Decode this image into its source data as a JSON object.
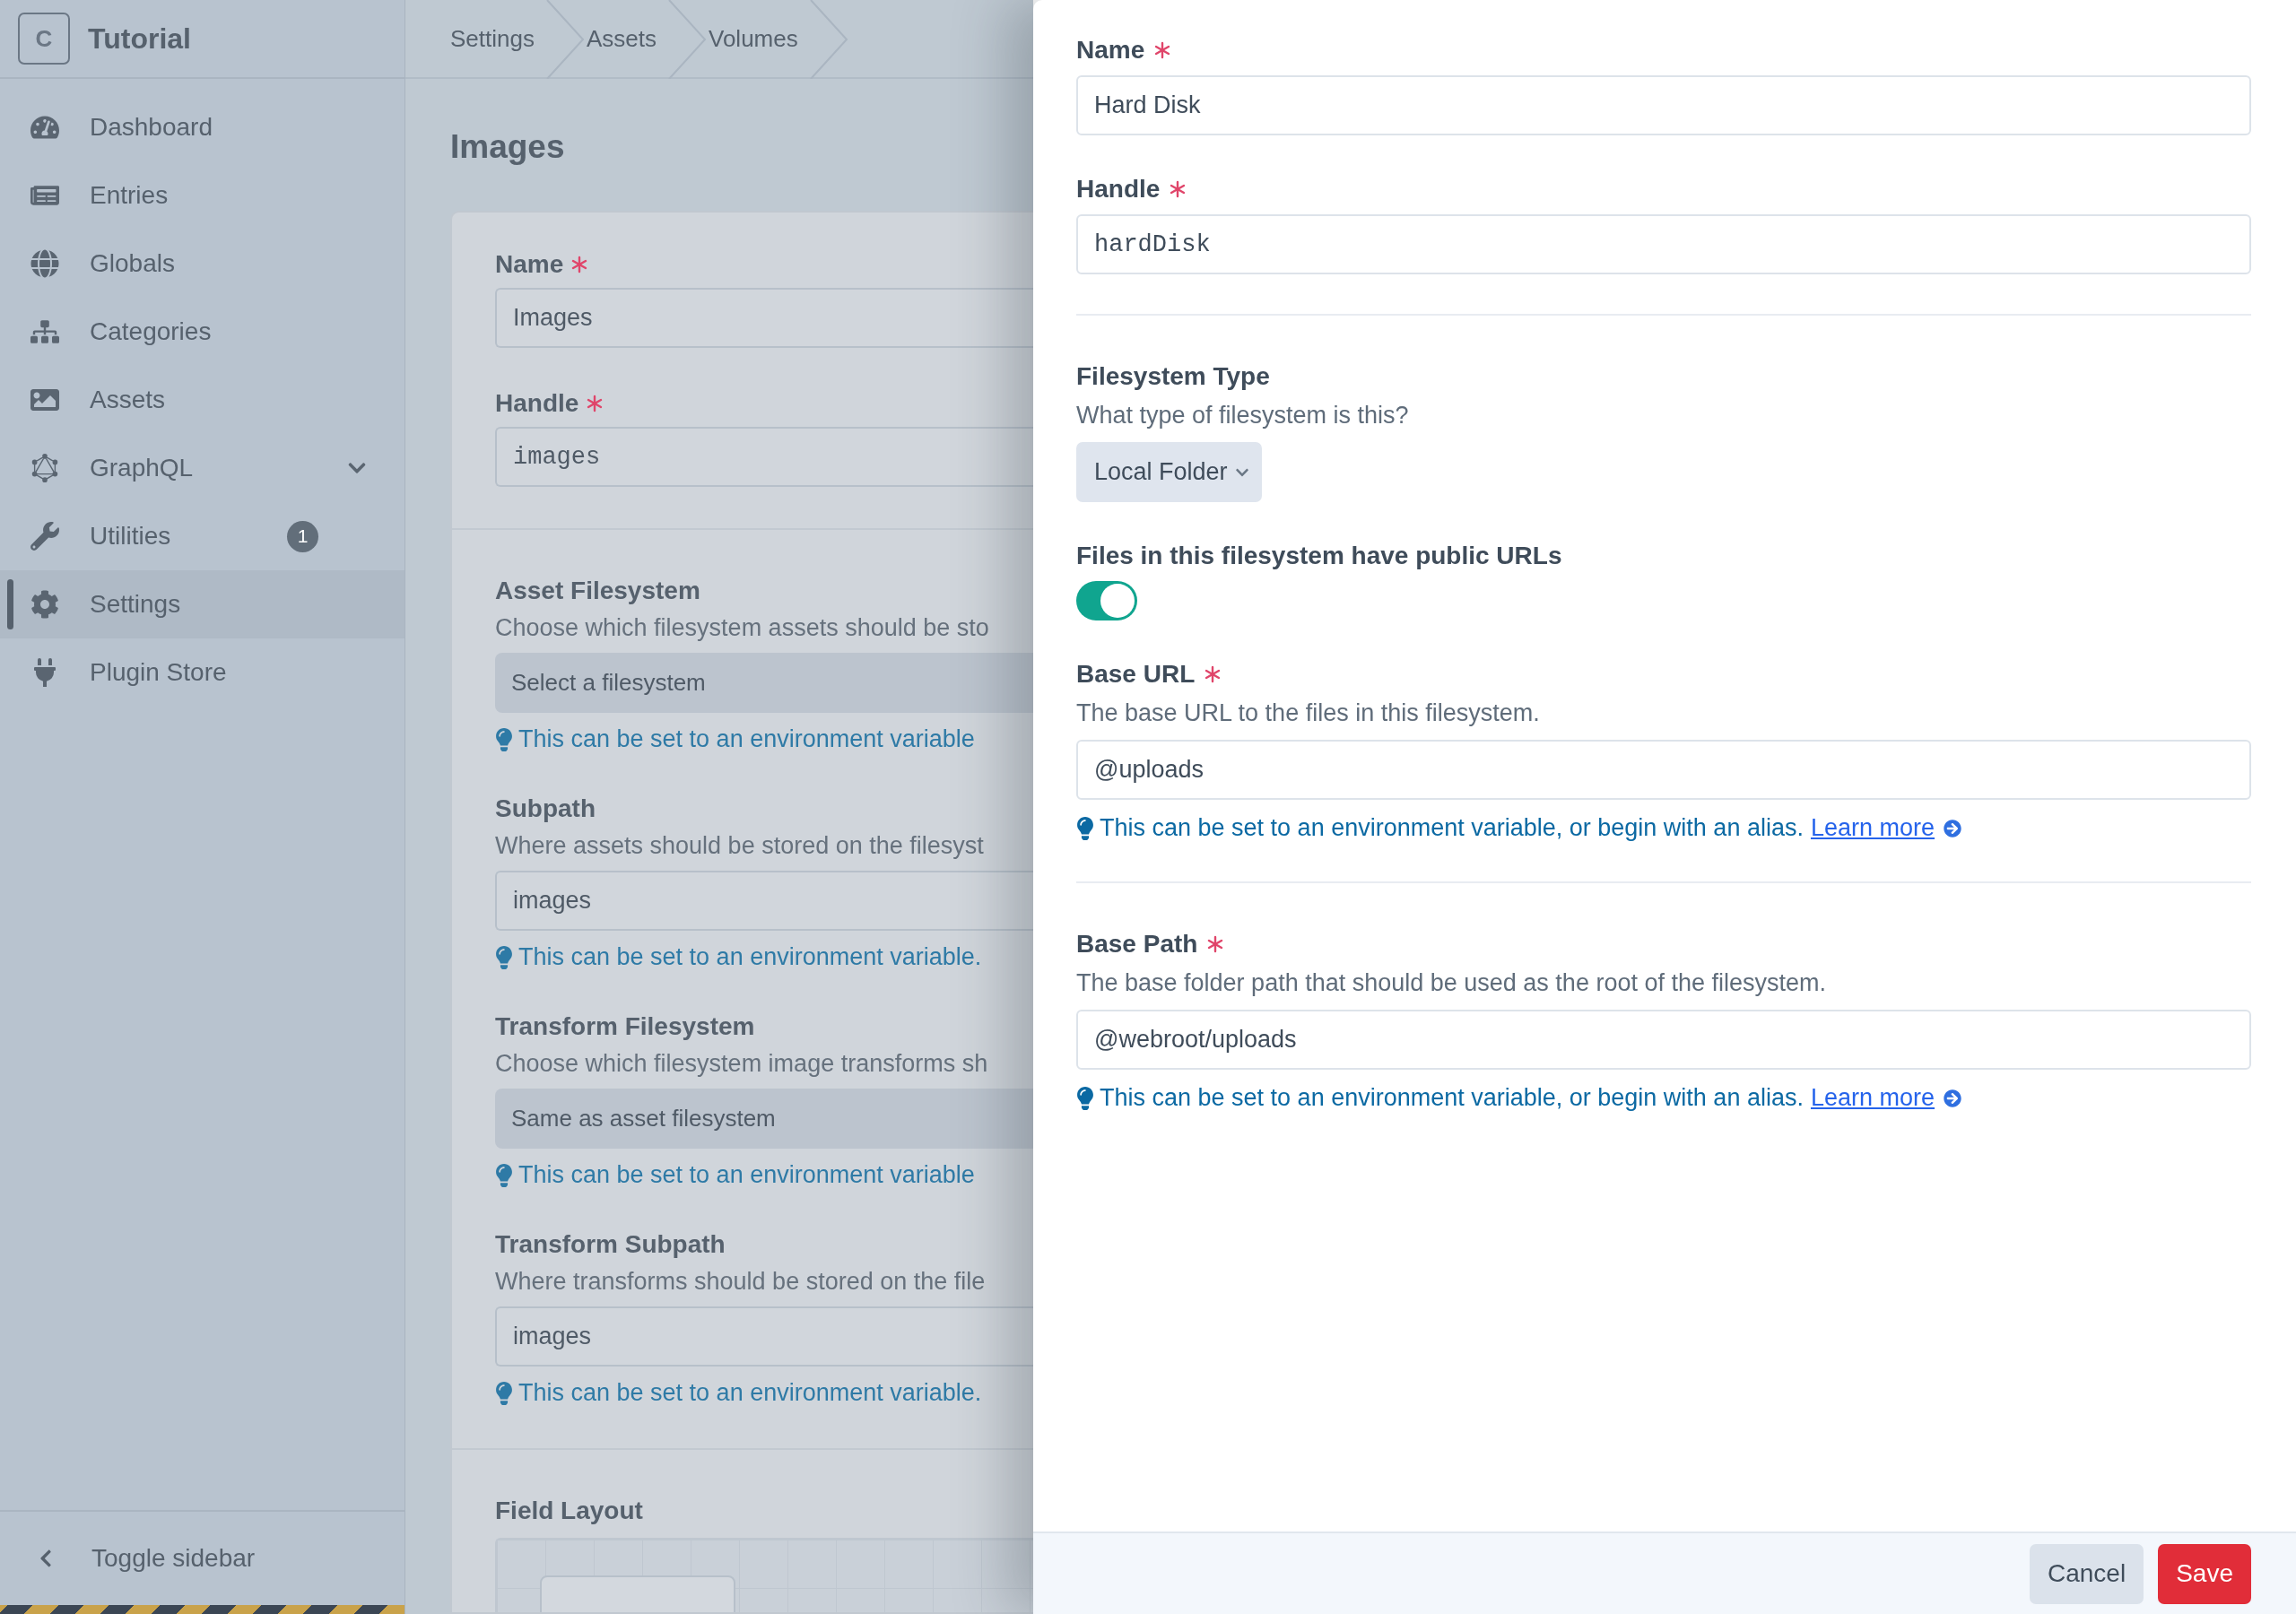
{
  "sidebar": {
    "logo_letter": "C",
    "site_name": "Tutorial",
    "items": [
      {
        "label": "Dashboard",
        "selected": false,
        "submenu": false
      },
      {
        "label": "Entries",
        "selected": false,
        "submenu": false
      },
      {
        "label": "Globals",
        "selected": false,
        "submenu": false
      },
      {
        "label": "Categories",
        "selected": false,
        "submenu": false
      },
      {
        "label": "Assets",
        "selected": false,
        "submenu": false
      },
      {
        "label": "GraphQL",
        "selected": false,
        "submenu": true
      },
      {
        "label": "Utilities",
        "selected": false,
        "submenu": false,
        "badge": "1"
      },
      {
        "label": "Settings",
        "selected": true,
        "submenu": false
      },
      {
        "label": "Plugin Store",
        "selected": false,
        "submenu": false
      }
    ],
    "toggle": "Toggle sidebar"
  },
  "breadcrumbs": [
    "Settings",
    "Assets",
    "Volumes"
  ],
  "page_title": "Images",
  "volume_form": {
    "fields": [
      {
        "kind": "text",
        "label": "Name",
        "required": true,
        "value": "Images",
        "mono": false
      },
      {
        "kind": "text",
        "label": "Handle",
        "required": true,
        "value": "images",
        "mono": true
      },
      {
        "kind": "divider"
      },
      {
        "kind": "select",
        "label": "Asset Filesystem",
        "required": false,
        "description": "Choose which filesystem assets should be sto",
        "value": "Select a filesystem",
        "hint": {
          "text": "This can be set to an environment variable"
        }
      },
      {
        "kind": "text",
        "label": "Subpath",
        "required": false,
        "description": "Where assets should be stored on the filesyst",
        "value": "images",
        "mono": false,
        "hint": {
          "text": "This can be set to an environment variable."
        }
      },
      {
        "kind": "select",
        "label": "Transform Filesystem",
        "required": false,
        "description": "Choose which filesystem image transforms sh",
        "value": "Same as asset filesystem",
        "hint": {
          "text": "This can be set to an environment variable"
        }
      },
      {
        "kind": "text",
        "label": "Transform Subpath",
        "required": false,
        "description": "Where transforms should be stored on the file",
        "value": "images",
        "mono": false,
        "hint": {
          "text": "This can be set to an environment variable."
        }
      },
      {
        "kind": "divider"
      }
    ],
    "field_layout_title": "Field Layout"
  },
  "filesystem_panel": {
    "fields": [
      {
        "kind": "text",
        "label": "Name",
        "required": true,
        "value": "Hard Disk",
        "mono": false
      },
      {
        "kind": "text",
        "label": "Handle",
        "required": true,
        "value": "hardDisk",
        "mono": true
      },
      {
        "kind": "divider"
      },
      {
        "kind": "select",
        "label": "Filesystem Type",
        "required": false,
        "description": "What type of filesystem is this?",
        "value": "Local Folder"
      },
      {
        "kind": "toggle",
        "label": "Files in this filesystem have public URLs",
        "required": false,
        "on": true
      },
      {
        "kind": "text",
        "label": "Base URL",
        "required": true,
        "description": "The base URL to the files in this filesystem.",
        "value": "@uploads",
        "mono": false,
        "hint": {
          "text": "This can be set to an environment variable, or begin with an alias.",
          "link": "Learn more"
        }
      },
      {
        "kind": "divider"
      },
      {
        "kind": "text",
        "label": "Base Path",
        "required": true,
        "description": "The base folder path that should be used as the root of the filesystem.",
        "value": "@webroot/uploads",
        "mono": false,
        "hint": {
          "text": "This can be set to an environment variable, or begin with an alias.",
          "link": "Learn more"
        }
      }
    ],
    "buttons": [
      {
        "label": "Cancel",
        "kind": "secondary"
      },
      {
        "label": "Save",
        "kind": "primary"
      }
    ]
  }
}
